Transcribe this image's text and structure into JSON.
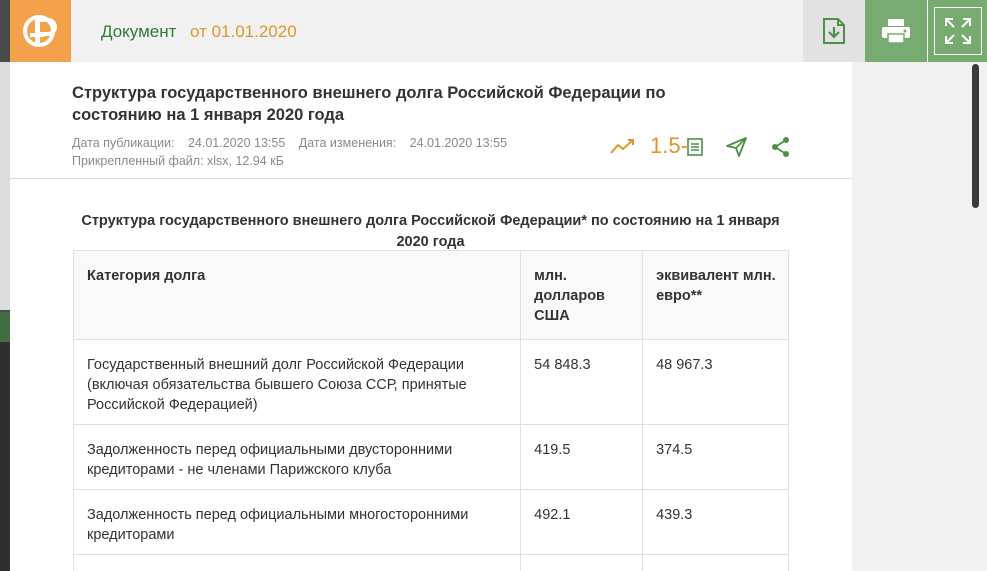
{
  "header": {
    "title": "Документ",
    "date": "от 01.01.2020",
    "logo_icon": "cbr-logo-icon",
    "buttons": [
      "download-icon",
      "print-icon",
      "fullscreen-icon"
    ]
  },
  "document": {
    "title": "Структура государственного внешнего долга Российской Федерации по состоянию на 1 января 2020 года",
    "published_label": "Дата публикации:",
    "published_value": "24.01.2020 13:55",
    "modified_label": "Дата изменения:",
    "modified_value": "24.01.2020 13:55",
    "attachment": "Прикрепленный файл: xlsx, 12.94 кБ",
    "zoom": "1.5",
    "action_icons": [
      "trend-icon",
      "zoom-doc-icon",
      "send-icon",
      "share-icon"
    ]
  },
  "table": {
    "caption": "Структура государственного внешнего долга Российской Федерации* по состоянию на 1 января 2020 года",
    "headers": [
      "Категория долга",
      "млн. долларов США",
      "эквивалент млн. евро**"
    ],
    "rows": [
      [
        "Государственный внешний  долг Российской Федерации (включая  обязательства бывшего Союза  ССР, принятые Российской Федерацией)",
        "54 848.3",
        "48 967.3"
      ],
      [
        "Задолженность перед официальными двусторонними кредиторами - не членами Парижского клуба",
        "419.5",
        "374.5"
      ],
      [
        "Задолженность перед официальными многосторонними кредиторами",
        "492.1",
        "439.3"
      ],
      [
        "",
        "",
        ""
      ]
    ]
  },
  "colors": {
    "brand_orange": "#f3a14a",
    "brand_green": "#78ab72",
    "title_green": "#2f7a35",
    "date_orange": "#e0962d"
  }
}
